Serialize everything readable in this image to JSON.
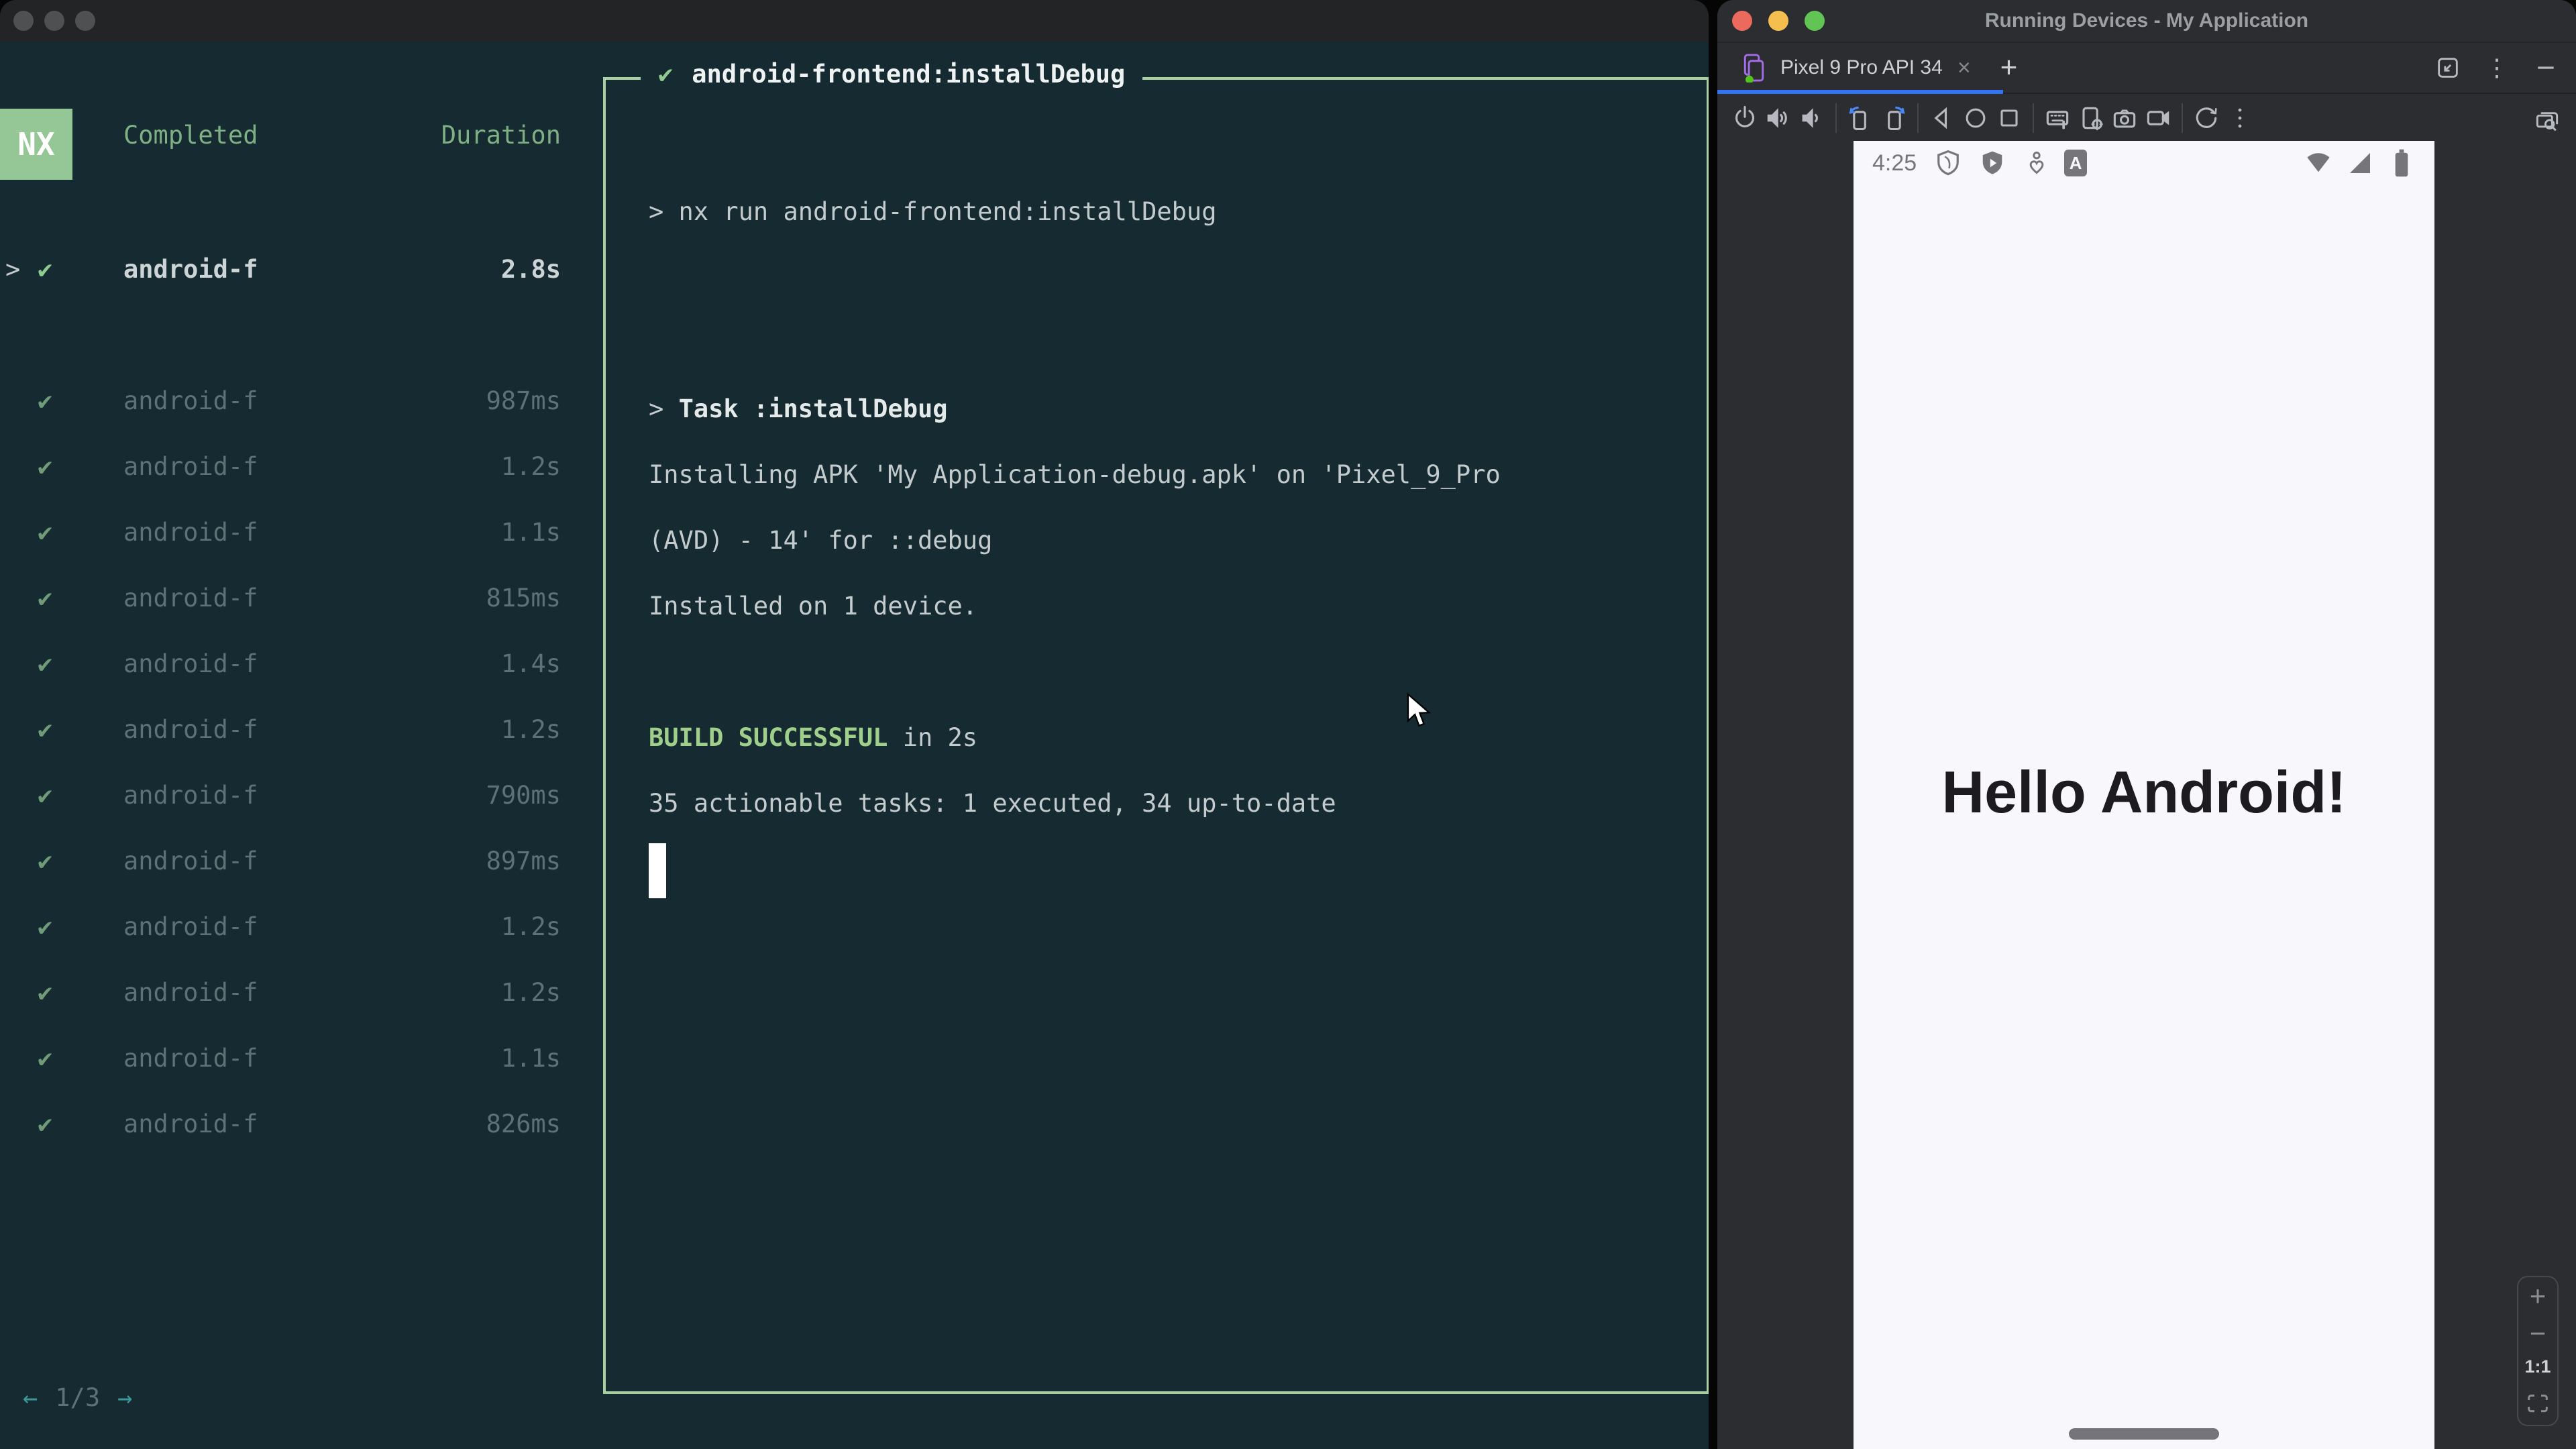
{
  "left_window": {
    "sidebar": {
      "logo": "NX",
      "columns": {
        "completed": "Completed",
        "duration": "Duration"
      },
      "selected_task": {
        "chevron": ">",
        "check": "✔",
        "name": "android-f",
        "duration": "2.8s"
      },
      "tasks": [
        {
          "check": "✔",
          "name": "android-f",
          "duration": "987ms"
        },
        {
          "check": "✔",
          "name": "android-f",
          "duration": "1.2s"
        },
        {
          "check": "✔",
          "name": "android-f",
          "duration": "1.1s"
        },
        {
          "check": "✔",
          "name": "android-f",
          "duration": "815ms"
        },
        {
          "check": "✔",
          "name": "android-f",
          "duration": "1.4s"
        },
        {
          "check": "✔",
          "name": "android-f",
          "duration": "1.2s"
        },
        {
          "check": "✔",
          "name": "android-f",
          "duration": "790ms"
        },
        {
          "check": "✔",
          "name": "android-f",
          "duration": "897ms"
        },
        {
          "check": "✔",
          "name": "android-f",
          "duration": "1.2s"
        },
        {
          "check": "✔",
          "name": "android-f",
          "duration": "1.2s"
        },
        {
          "check": "✔",
          "name": "android-f",
          "duration": "1.1s"
        },
        {
          "check": "✔",
          "name": "android-f",
          "duration": "826ms"
        }
      ],
      "pagination": {
        "prev": "←",
        "current": "1/3",
        "next": "→"
      }
    },
    "terminal": {
      "title_check": "✔",
      "title": "android-frontend:installDebug",
      "lines": {
        "cmd": "> nx run android-frontend:installDebug",
        "task_prefix": "> ",
        "task": "Task :installDebug",
        "install1": "Installing APK 'My Application-debug.apk' on 'Pixel_9_Pro",
        "install2": "(AVD) - 14' for ::debug",
        "install3": "Installed on 1 device.",
        "build_label": "BUILD SUCCESSFUL",
        "build_suffix": " in 2s",
        "summary": "35 actionable tasks: 1 executed, 34 up-to-date"
      }
    }
  },
  "right_window": {
    "title": "Running Devices - My Application",
    "tab": {
      "label": "Pixel 9 Pro API 34",
      "close": "×",
      "new_tab": "+",
      "more": "⋮",
      "hide": "—"
    },
    "toolbar": {
      "groups": [
        [
          "power",
          "volume-up",
          "volume-down"
        ],
        [
          "rotate-left",
          "rotate-right"
        ],
        [
          "back",
          "home",
          "overview"
        ],
        [
          "virtual-keyboard",
          "device-settings",
          "screenshot",
          "screen-record"
        ],
        [
          "restart",
          "more-vertical"
        ]
      ],
      "right": [
        "device-mirroring"
      ]
    },
    "device": {
      "status_time": "4:25",
      "letter_badge": "A",
      "hello_text": "Hello Android!"
    },
    "zoom_controls": {
      "zoom_in": "+",
      "zoom_out": "−",
      "actual_size": "1:1"
    }
  },
  "colors": {
    "nx_green": "#94c795",
    "terminal_border_green": "#a8cfa0",
    "build_success_green": "#9fcf8b",
    "pagination_teal": "#3f969b",
    "tab_active_blue": "#3574f0",
    "traffic_red": "#ec6a5d",
    "traffic_yellow": "#f4bf4f",
    "traffic_green": "#61c455",
    "terminal_bg": "#152a31",
    "ide_bg": "#2b2d30",
    "phone_screen_bg": "#f8f7fb"
  }
}
